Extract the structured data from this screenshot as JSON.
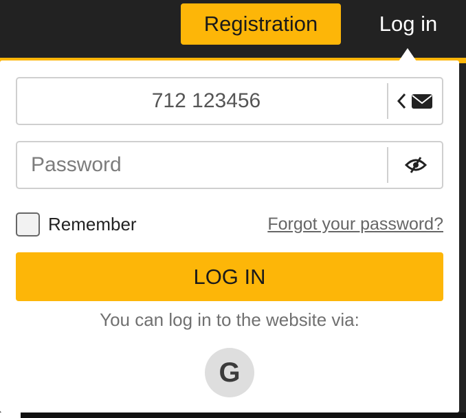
{
  "header": {
    "registration_label": "Registration",
    "login_label": "Log in"
  },
  "login_form": {
    "phone": {
      "value": "712 123456",
      "placeholder": "712 123456",
      "icons": [
        "chevron-left-icon",
        "envelope-icon"
      ]
    },
    "password": {
      "value": "",
      "placeholder": "Password",
      "icon": "eye-slash-icon"
    },
    "remember_label": "Remember",
    "remember_checked": false,
    "forgot_label": "Forgot your password?",
    "submit_label": "LOG IN",
    "social_prompt": "You can log in to the website via:",
    "social": [
      {
        "name": "google-icon",
        "glyph": "G"
      }
    ]
  },
  "colors": {
    "accent": "#fdb608",
    "header_bg": "#222222",
    "panel_bg": "#ffffff",
    "border": "#cfcfcf",
    "muted_text": "#707070"
  }
}
